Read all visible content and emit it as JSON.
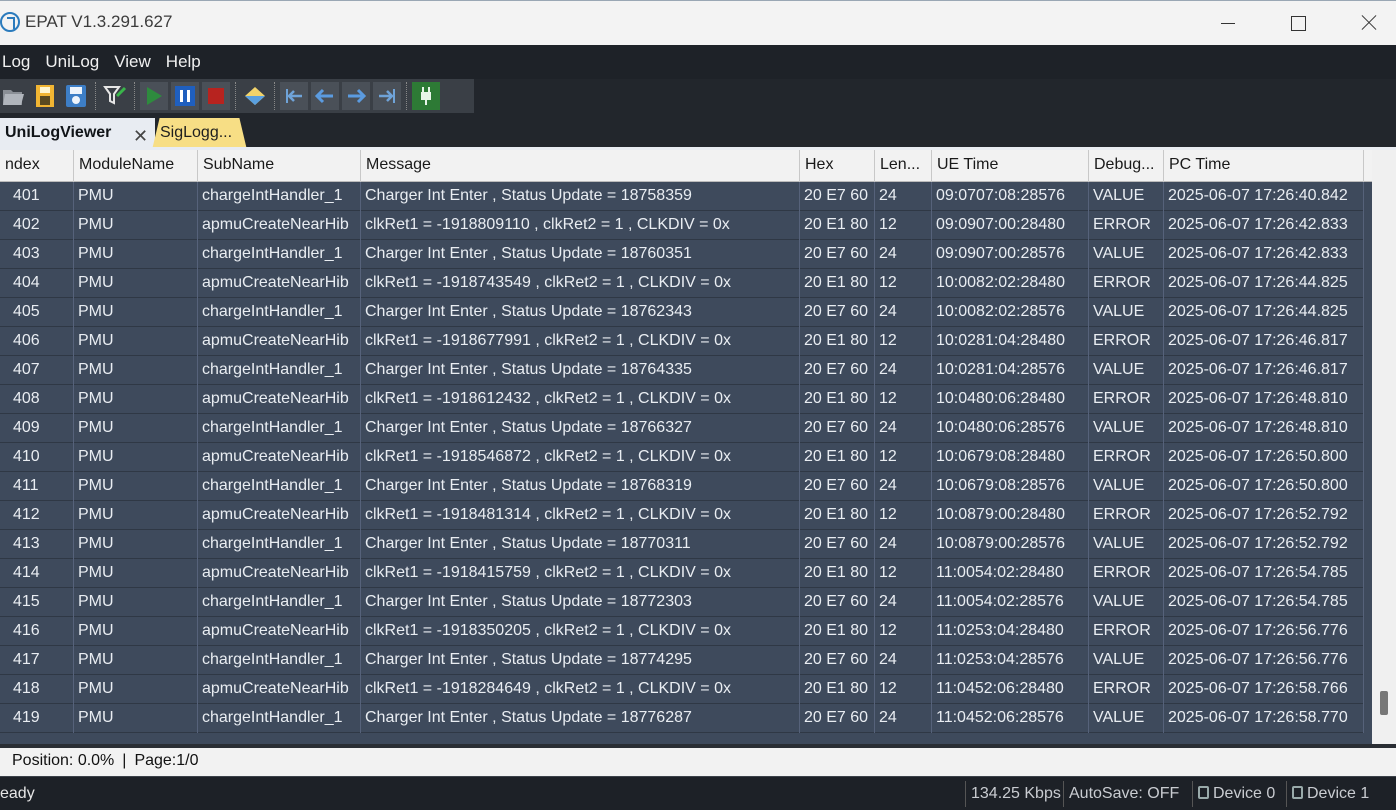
{
  "window": {
    "title": "EPAT V1.3.291.627"
  },
  "menu": {
    "items": [
      "Log",
      "UniLog",
      "View",
      "Help"
    ]
  },
  "toolbar": {
    "icons": [
      "open-folder-icon",
      "save-file-icon",
      "save-disk-icon",
      "filter-icon",
      "play-icon",
      "pause-icon",
      "stop-icon",
      "clear-icon",
      "first-icon",
      "prev-icon",
      "next-icon",
      "last-icon",
      "connect-icon"
    ],
    "colors": {
      "play": "#2e8b3e",
      "pause": "#1f5fbf",
      "stop": "#b7231f"
    }
  },
  "tabs": {
    "active": "UniLogViewer",
    "other": "SigLogg..."
  },
  "grid": {
    "columns": [
      "ndex",
      "ModuleName",
      "SubName",
      "Message",
      "Hex",
      "Len...",
      "UE Time",
      "Debug...",
      "PC Time"
    ],
    "rows": [
      [
        "401",
        "PMU",
        "chargeIntHandler_1",
        "Charger Int Enter , Status Update = 18758359",
        "20 E7 60",
        "24",
        "09:0707:08:28576",
        "VALUE",
        "2025-06-07 17:26:40.842"
      ],
      [
        "402",
        "PMU",
        "apmuCreateNearHib",
        "clkRet1 = -1918809110 , clkRet2 = 1 , CLKDIV = 0x",
        "20 E1 80",
        "12",
        "09:0907:00:28480",
        "ERROR",
        "2025-06-07 17:26:42.833"
      ],
      [
        "403",
        "PMU",
        "chargeIntHandler_1",
        "Charger Int Enter , Status Update = 18760351",
        "20 E7 60",
        "24",
        "09:0907:00:28576",
        "VALUE",
        "2025-06-07 17:26:42.833"
      ],
      [
        "404",
        "PMU",
        "apmuCreateNearHib",
        "clkRet1 = -1918743549 , clkRet2 = 1 , CLKDIV = 0x",
        "20 E1 80",
        "12",
        "10:0082:02:28480",
        "ERROR",
        "2025-06-07 17:26:44.825"
      ],
      [
        "405",
        "PMU",
        "chargeIntHandler_1",
        "Charger Int Enter , Status Update = 18762343",
        "20 E7 60",
        "24",
        "10:0082:02:28576",
        "VALUE",
        "2025-06-07 17:26:44.825"
      ],
      [
        "406",
        "PMU",
        "apmuCreateNearHib",
        "clkRet1 = -1918677991 , clkRet2 = 1 , CLKDIV = 0x",
        "20 E1 80",
        "12",
        "10:0281:04:28480",
        "ERROR",
        "2025-06-07 17:26:46.817"
      ],
      [
        "407",
        "PMU",
        "chargeIntHandler_1",
        "Charger Int Enter , Status Update = 18764335",
        "20 E7 60",
        "24",
        "10:0281:04:28576",
        "VALUE",
        "2025-06-07 17:26:46.817"
      ],
      [
        "408",
        "PMU",
        "apmuCreateNearHib",
        "clkRet1 = -1918612432 , clkRet2 = 1 , CLKDIV = 0x",
        "20 E1 80",
        "12",
        "10:0480:06:28480",
        "ERROR",
        "2025-06-07 17:26:48.810"
      ],
      [
        "409",
        "PMU",
        "chargeIntHandler_1",
        "Charger Int Enter , Status Update = 18766327",
        "20 E7 60",
        "24",
        "10:0480:06:28576",
        "VALUE",
        "2025-06-07 17:26:48.810"
      ],
      [
        "410",
        "PMU",
        "apmuCreateNearHib",
        "clkRet1 = -1918546872 , clkRet2 = 1 , CLKDIV = 0x",
        "20 E1 80",
        "12",
        "10:0679:08:28480",
        "ERROR",
        "2025-06-07 17:26:50.800"
      ],
      [
        "411",
        "PMU",
        "chargeIntHandler_1",
        "Charger Int Enter , Status Update = 18768319",
        "20 E7 60",
        "24",
        "10:0679:08:28576",
        "VALUE",
        "2025-06-07 17:26:50.800"
      ],
      [
        "412",
        "PMU",
        "apmuCreateNearHib",
        "clkRet1 = -1918481314 , clkRet2 = 1 , CLKDIV = 0x",
        "20 E1 80",
        "12",
        "10:0879:00:28480",
        "ERROR",
        "2025-06-07 17:26:52.792"
      ],
      [
        "413",
        "PMU",
        "chargeIntHandler_1",
        "Charger Int Enter , Status Update = 18770311",
        "20 E7 60",
        "24",
        "10:0879:00:28576",
        "VALUE",
        "2025-06-07 17:26:52.792"
      ],
      [
        "414",
        "PMU",
        "apmuCreateNearHib",
        "clkRet1 = -1918415759 , clkRet2 = 1 , CLKDIV = 0x",
        "20 E1 80",
        "12",
        "11:0054:02:28480",
        "ERROR",
        "2025-06-07 17:26:54.785"
      ],
      [
        "415",
        "PMU",
        "chargeIntHandler_1",
        "Charger Int Enter , Status Update = 18772303",
        "20 E7 60",
        "24",
        "11:0054:02:28576",
        "VALUE",
        "2025-06-07 17:26:54.785"
      ],
      [
        "416",
        "PMU",
        "apmuCreateNearHib",
        "clkRet1 = -1918350205 , clkRet2 = 1 , CLKDIV = 0x",
        "20 E1 80",
        "12",
        "11:0253:04:28480",
        "ERROR",
        "2025-06-07 17:26:56.776"
      ],
      [
        "417",
        "PMU",
        "chargeIntHandler_1",
        "Charger Int Enter , Status Update = 18774295",
        "20 E7 60",
        "24",
        "11:0253:04:28576",
        "VALUE",
        "2025-06-07 17:26:56.776"
      ],
      [
        "418",
        "PMU",
        "apmuCreateNearHib",
        "clkRet1 = -1918284649 , clkRet2 = 1 , CLKDIV = 0x",
        "20 E1 80",
        "12",
        "11:0452:06:28480",
        "ERROR",
        "2025-06-07 17:26:58.766"
      ],
      [
        "419",
        "PMU",
        "chargeIntHandler_1",
        "Charger Int Enter , Status Update = 18776287",
        "20 E7 60",
        "24",
        "11:0452:06:28576",
        "VALUE",
        "2025-06-07 17:26:58.770"
      ]
    ]
  },
  "position": {
    "text": "Position: 0.0%",
    "separator": "|",
    "page": "Page:1/0"
  },
  "status": {
    "ready": "eady",
    "kbps": "134.25 Kbps",
    "autosave": "AutoSave: OFF",
    "device0": "Device 0",
    "device1": "Device 1"
  }
}
